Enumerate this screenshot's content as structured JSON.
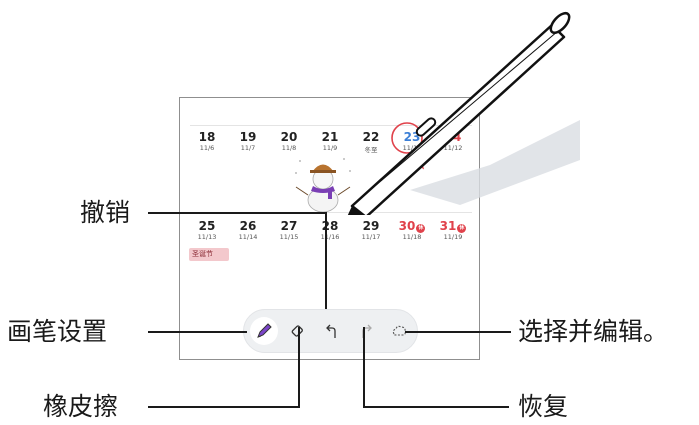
{
  "calendar": {
    "week1": [
      {
        "day": "18",
        "lunar": "11/6"
      },
      {
        "day": "19",
        "lunar": "11/7"
      },
      {
        "day": "20",
        "lunar": "11/8"
      },
      {
        "day": "21",
        "lunar": "11/9"
      },
      {
        "day": "22",
        "lunar": "冬至"
      },
      {
        "day": "23",
        "lunar": "11/11"
      },
      {
        "day": "24",
        "lunar": "11/12"
      }
    ],
    "week2": [
      {
        "day": "25",
        "lunar": "11/13"
      },
      {
        "day": "26",
        "lunar": "11/14"
      },
      {
        "day": "27",
        "lunar": "11/15"
      },
      {
        "day": "28",
        "lunar": "11/16"
      },
      {
        "day": "29",
        "lunar": "11/17"
      },
      {
        "day": "30",
        "lunar": "11/18"
      },
      {
        "day": "31",
        "lunar": "11/19"
      }
    ],
    "event_label": "圣诞节",
    "badge_text": "休"
  },
  "toolbar": {
    "tools": [
      {
        "name": "pen-settings",
        "icon": "pen-icon"
      },
      {
        "name": "eraser",
        "icon": "eraser-icon"
      },
      {
        "name": "undo",
        "icon": "undo-icon"
      },
      {
        "name": "redo",
        "icon": "redo-icon"
      },
      {
        "name": "select-edit",
        "icon": "lasso-icon"
      }
    ]
  },
  "callouts": {
    "undo": "撤销",
    "pen_settings": "画笔设置",
    "eraser": "橡皮擦",
    "select_edit": "选择并编辑。",
    "redo": "恢复"
  },
  "colors": {
    "accent_red": "#e0424b",
    "accent_blue": "#3c7fd6",
    "toolbar_bg": "#eef0f2"
  }
}
